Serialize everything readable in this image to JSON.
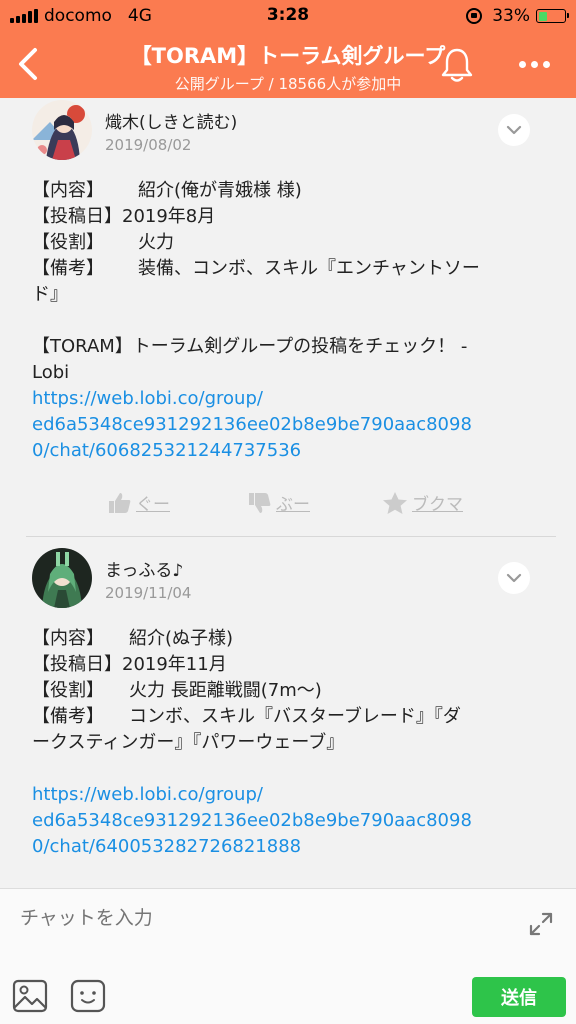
{
  "status_bar": {
    "carrier": "docomo",
    "network": "4G",
    "time": "3:28",
    "battery": "33%",
    "battery_level": 0.33
  },
  "header": {
    "title": "【TORAM】トーラム剣グループ",
    "subtitle": "公開グループ / 18566人が参加中",
    "back_icon": "chevron-left-icon",
    "bell_icon": "bell-icon",
    "more_icon": "more-dots-icon"
  },
  "posts": [
    {
      "author": "熾木(しきと読む)",
      "date": "2019/08/02",
      "lines": [
        {
          "label": "【内容】",
          "value": "紹介(俺が青娥様 様)"
        },
        {
          "label": "【投稿日】",
          "value": "2019年8月"
        },
        {
          "label": "【役割】",
          "value": "火力"
        },
        {
          "label": "【備考】",
          "value": "装備、コンボ、スキル『エンチャントソー"
        }
      ],
      "continuation": "ド』",
      "share_line1": "【TORAM】トーラム剣グループの投稿をチェック！ -",
      "share_line2": "Lobi",
      "link_line1": "https://web.lobi.co/group/",
      "link_line2": "ed6a5348ce931292136ee02b8e9be790aac8098",
      "link_line3": "0/chat/606825321244737536",
      "actions": {
        "good": "ぐー",
        "boo": "ぶー",
        "bookmark": "ブクマ"
      }
    },
    {
      "author": "まっふる♪",
      "date": "2019/11/04",
      "lines": [
        {
          "label": "【内容】",
          "value": "紹介(ぬ子様)"
        },
        {
          "label": "【投稿日】",
          "value": "2019年11月"
        },
        {
          "label": "【役割】",
          "value": "火力  長距離戦闘(7m〜)"
        },
        {
          "label": "【備考】",
          "value": "コンボ、スキル『バスターブレード』『ダ"
        }
      ],
      "continuation": "ークスティンガー』『パワーウェーブ』",
      "link_line1": "https://web.lobi.co/group/",
      "link_line2": "ed6a5348ce931292136ee02b8e9be790aac8098",
      "link_line3": "0/chat/640053282726821888"
    }
  ],
  "composer": {
    "placeholder": "チャットを入力",
    "send_label": "送信"
  },
  "colors": {
    "header": "#fb7b50",
    "link": "#1a8fe3",
    "send": "#2ec44a"
  }
}
